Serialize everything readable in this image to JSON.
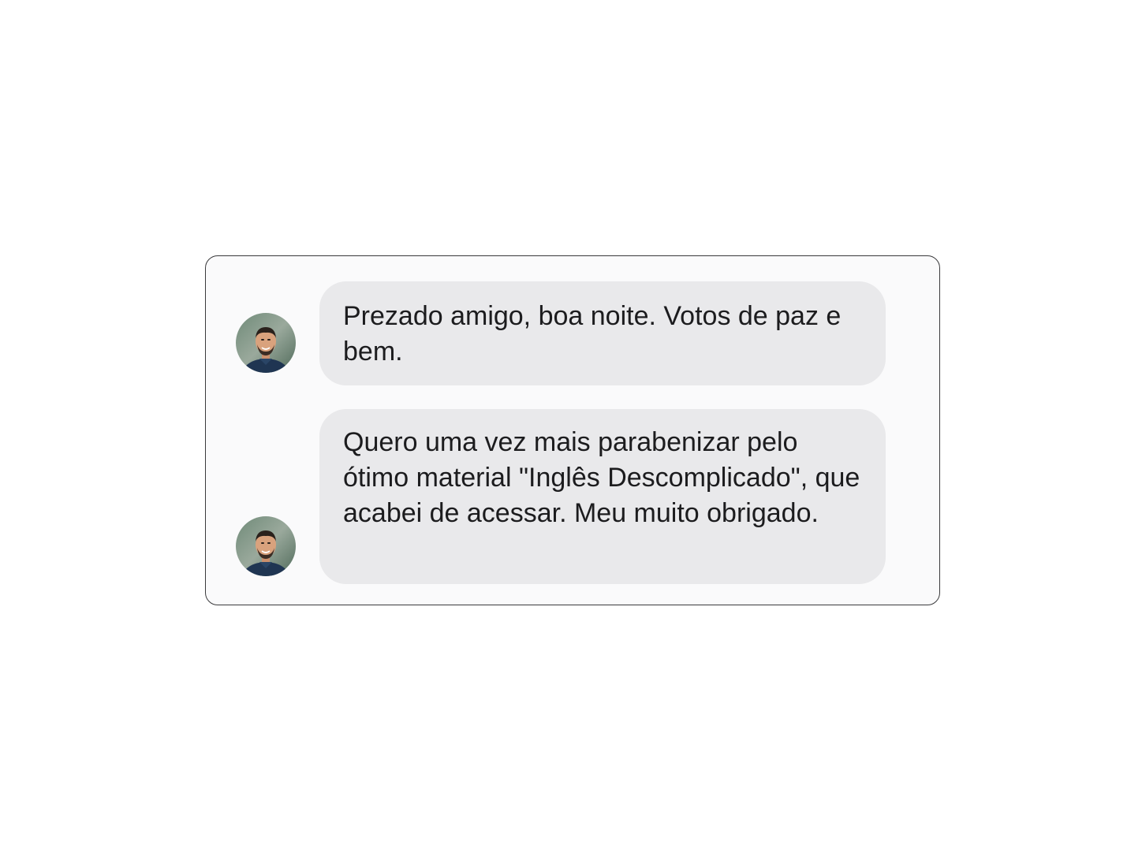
{
  "chat": {
    "messages": [
      {
        "avatar_icon": "person-avatar-icon",
        "text": "Prezado amigo, boa noite. Votos de paz e bem."
      },
      {
        "avatar_icon": "person-avatar-icon",
        "text": "Quero uma vez mais parabenizar pelo ótimo material \"Inglês Descomplicado\", que acabei de acessar. Meu muito obrigado."
      }
    ]
  },
  "colors": {
    "bubble_background": "#e9e9eb",
    "text": "#1c1c1e",
    "card_border": "#3a3a3c",
    "page_background": "#ffffff"
  }
}
